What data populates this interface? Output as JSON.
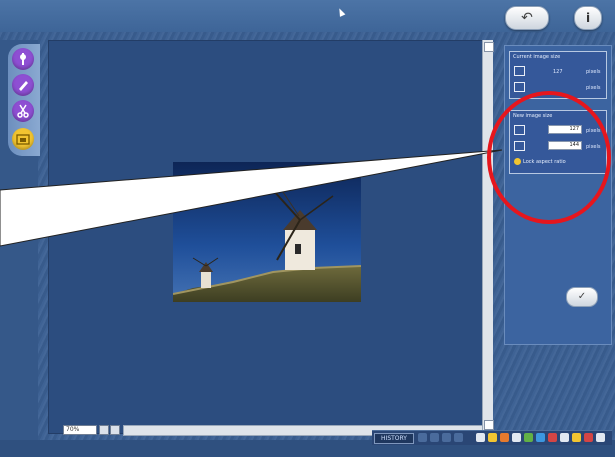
{
  "header": {
    "undo_label": "↶",
    "info_label": "i"
  },
  "tools": [
    {
      "name": "adjust-tool",
      "color": "#8e4fd3"
    },
    {
      "name": "brush-tool",
      "color": "#8e4fd3"
    },
    {
      "name": "crop-tool",
      "color": "#8e4fd3"
    },
    {
      "name": "resize-tool",
      "color": "#f2c531",
      "active": true
    }
  ],
  "panel": {
    "current_size_title": "Current image size",
    "current_width": "127",
    "current_height": "",
    "unit": "pixels",
    "new_size_title": "New image size",
    "new_width": "127",
    "new_height": "144",
    "lock_label": "Lock aspect ratio",
    "apply_icon": "checkmark-icon"
  },
  "footer": {
    "zoom_value": "70%",
    "size_badge": "HISTORY"
  },
  "colors": {
    "accent": "#f2c531",
    "callout": "#e6161d",
    "panel": "#3c64a0"
  }
}
